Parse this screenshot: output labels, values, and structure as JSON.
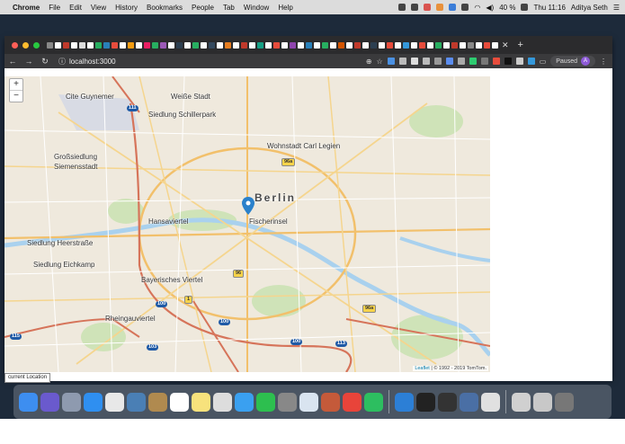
{
  "menubar": {
    "app_name": "Chrome",
    "items": [
      "File",
      "Edit",
      "View",
      "History",
      "Bookmarks",
      "People",
      "Tab",
      "Window",
      "Help"
    ],
    "battery": "40 %",
    "clock": "Thu 11:16",
    "user": "Aditya Seth"
  },
  "browser": {
    "url": "localhost:3000",
    "paused_label": "Paused",
    "avatar_letter": "A",
    "new_tab": "+",
    "close_tab": "✕"
  },
  "map": {
    "zoom_in": "+",
    "zoom_out": "−",
    "attribution_link": "Leaflet",
    "attribution_text": "| © 1992 - 2019 TomTom.",
    "labels": {
      "berlin": "Berlin",
      "cite_guynemer": "Cite Guynemer",
      "weisse_stadt": "Weiße Stadt",
      "schillerpark": "Siedlung Schillerpark",
      "grosssiedlung": "Großsiedlung",
      "siemensstadt": "Siemensstadt",
      "carl_legien": "Wohnstadt Carl Legien",
      "hansaviertel": "Hansaviertel",
      "fischerinsel": "Fischerinsel",
      "heerstrasse": "Siedlung Heerstraße",
      "eichkamp": "Siedlung Eichkamp",
      "bayerisches": "Bayerisches Viertel",
      "rheingau": "Rheingauviertel"
    },
    "shields": {
      "s96a_top": "96a",
      "s96a_bot": "96a",
      "s96": "96",
      "s1": "1",
      "s100_a": "100",
      "s100_b": "100",
      "s100_c": "100",
      "s113": "113",
      "s103": "103",
      "s111": "111",
      "s115": "115"
    }
  },
  "status": {
    "current_location": "current Location"
  }
}
